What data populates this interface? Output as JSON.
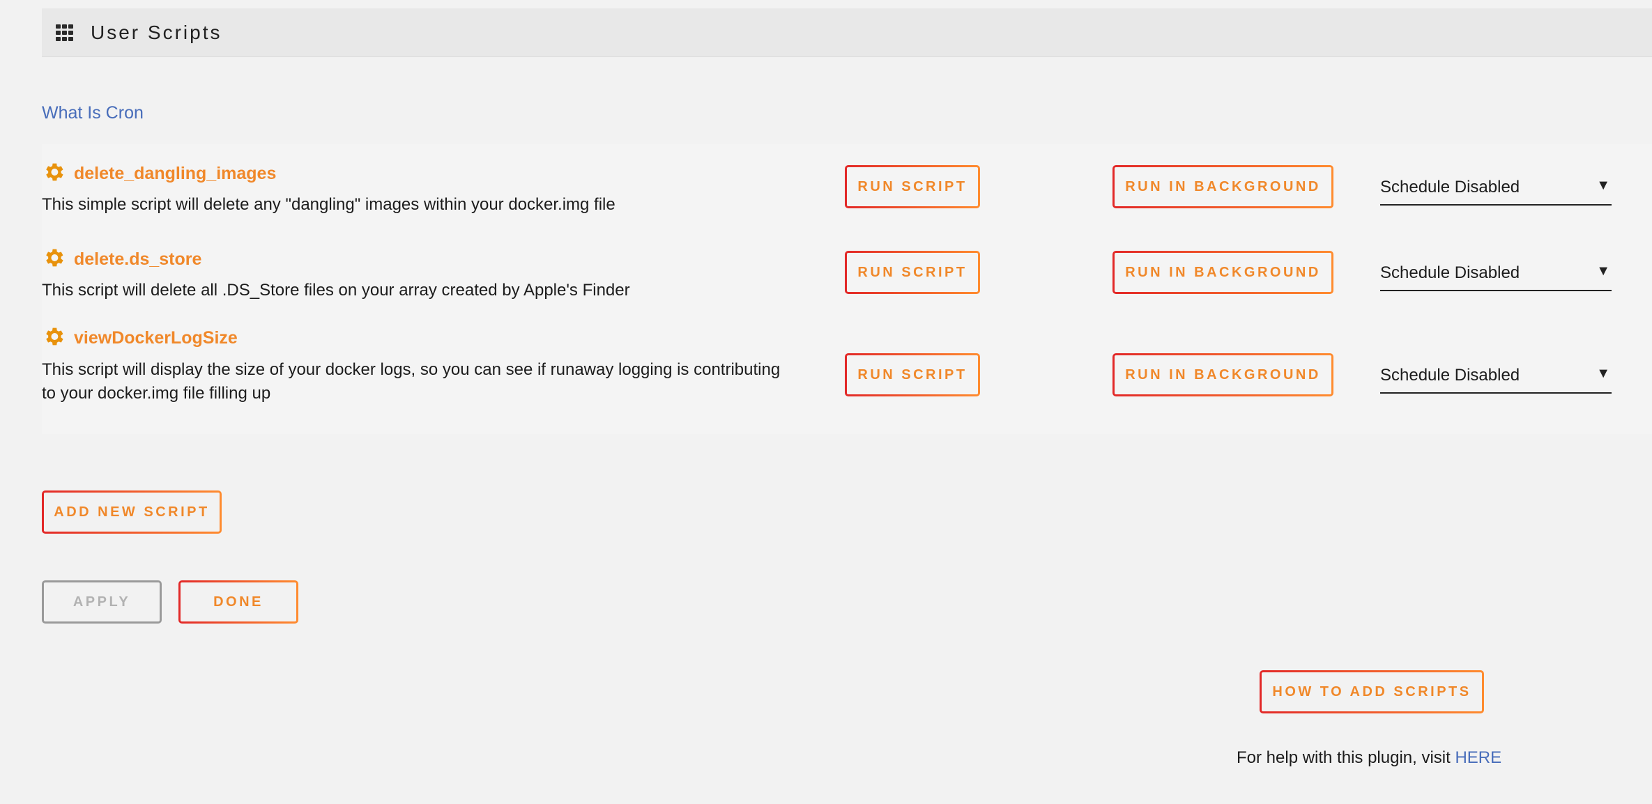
{
  "header": {
    "title": "User Scripts",
    "icon": "grid-icon"
  },
  "links": {
    "what_is_cron": "What Is Cron"
  },
  "scripts": [
    {
      "name": "delete_dangling_images",
      "description": "This simple script will delete any \"dangling\" images within your docker.img file",
      "run_label": "RUN SCRIPT",
      "background_label": "RUN IN BACKGROUND",
      "schedule": "Schedule Disabled"
    },
    {
      "name": "delete.ds_store",
      "description": "This script will delete all .DS_Store files on your array created by Apple's Finder",
      "run_label": "RUN SCRIPT",
      "background_label": "RUN IN BACKGROUND",
      "schedule": "Schedule Disabled"
    },
    {
      "name": "viewDockerLogSize",
      "description": "This script will display the size of your docker logs, so you can see if runaway logging is contributing to your docker.img file filling up",
      "run_label": "RUN SCRIPT",
      "background_label": "RUN IN BACKGROUND",
      "schedule": "Schedule Disabled"
    }
  ],
  "actions": {
    "add_new_script": "ADD NEW SCRIPT",
    "apply": "APPLY",
    "done": "DONE",
    "how_to_add": "HOW TO ADD SCRIPTS"
  },
  "footer": {
    "help_text": "For help with this plugin, visit ",
    "help_link": "HERE"
  },
  "colors": {
    "accent_orange": "#f0882a",
    "gradient_start": "#e22828",
    "gradient_end": "#ff8c2f",
    "link_blue": "#486dba"
  }
}
